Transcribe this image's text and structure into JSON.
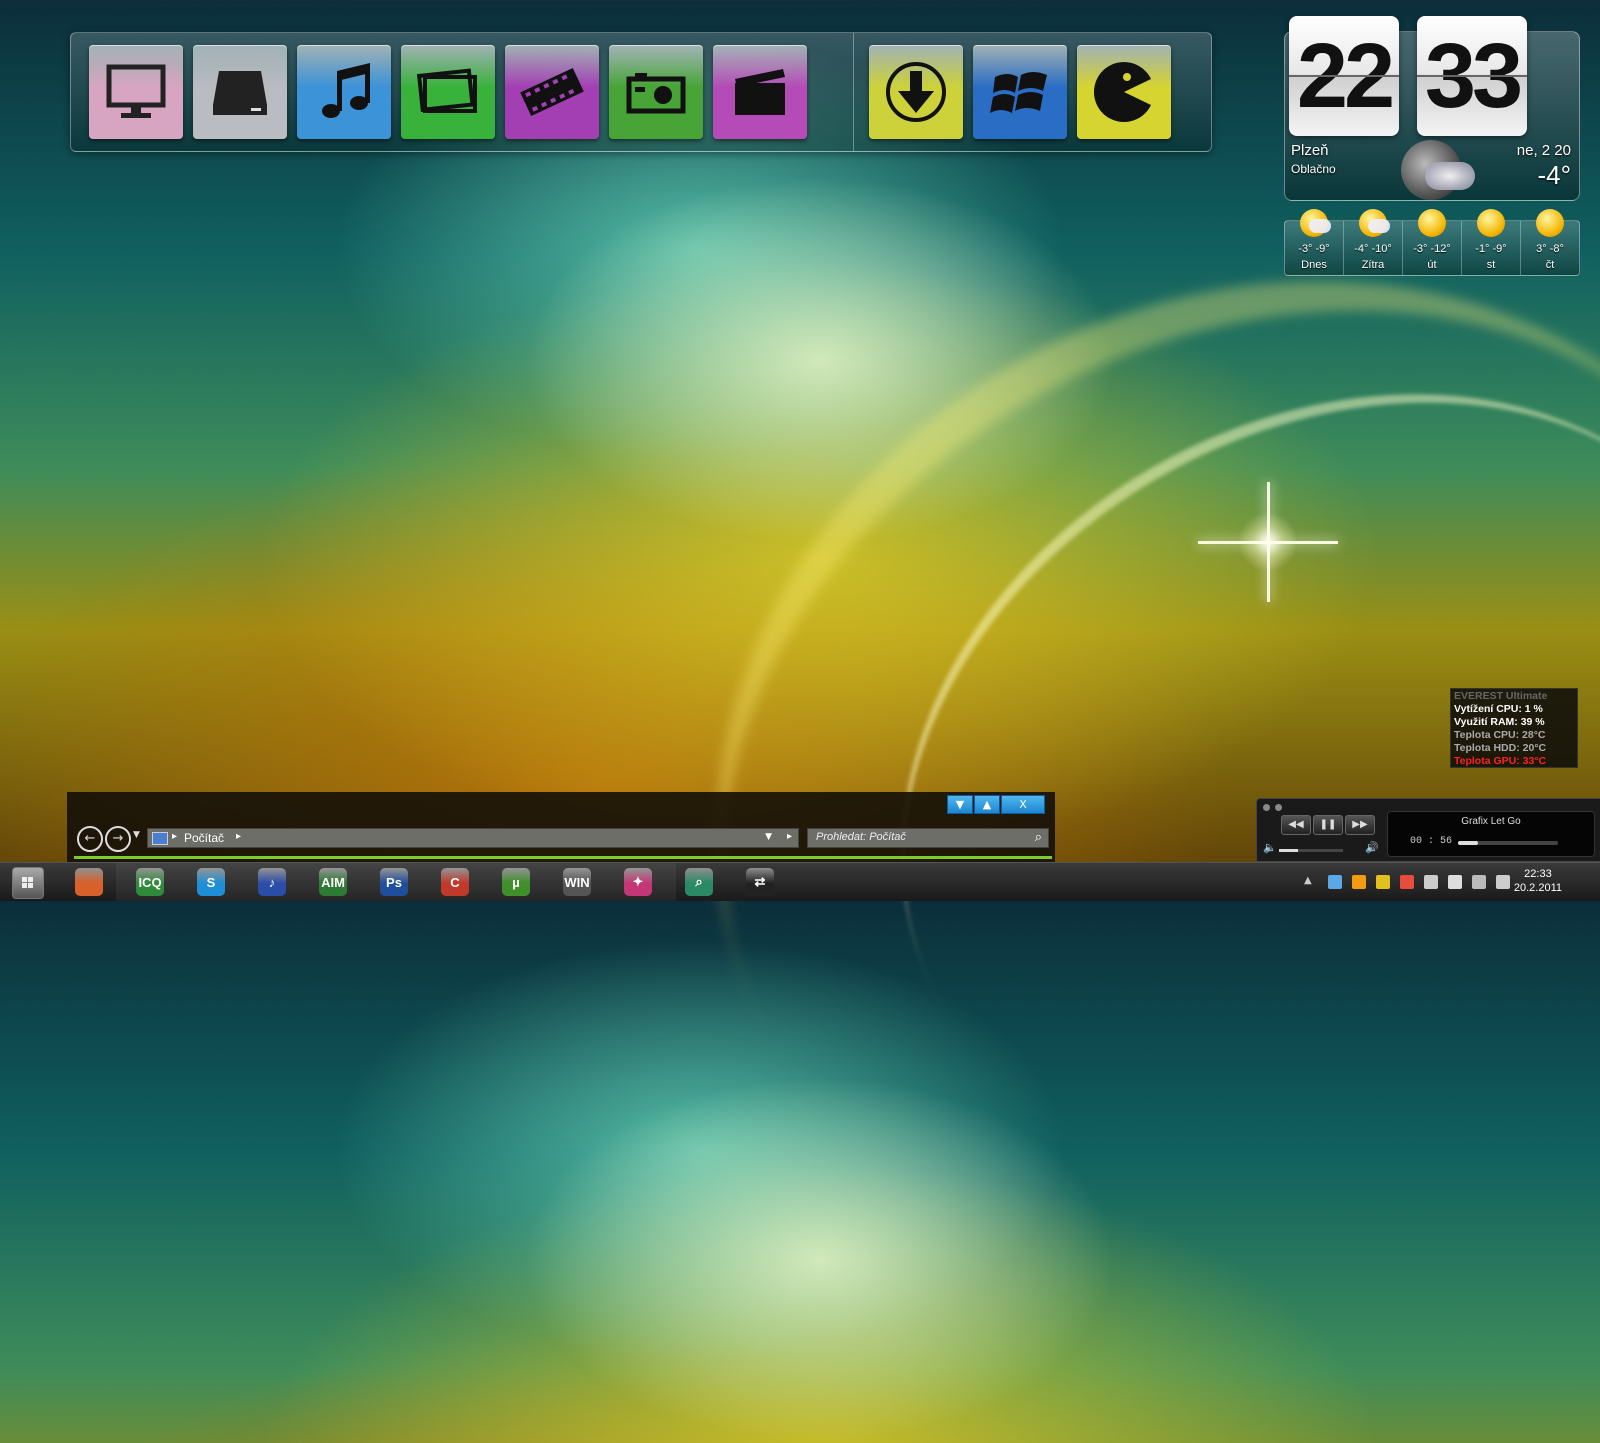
{
  "dock": {
    "tiles": [
      {
        "name": "monitor-icon",
        "color": "#d7a5c1"
      },
      {
        "name": "hard-drive-icon",
        "color": "#b9bcc1"
      },
      {
        "name": "music-note-icon",
        "color": "#3c93d8"
      },
      {
        "name": "pictures-icon",
        "color": "#39b23b"
      },
      {
        "name": "film-strip-icon",
        "color": "#a33fb3"
      },
      {
        "name": "camera-icon",
        "color": "#48a436"
      },
      {
        "name": "clapperboard-icon",
        "color": "#b54bb6"
      },
      {
        "name": "download-icon",
        "color": "#cdd23a"
      },
      {
        "name": "windows-logo-icon",
        "color": "#2a6dc4"
      },
      {
        "name": "pacman-icon",
        "color": "#d6d431"
      }
    ]
  },
  "clock": {
    "hours": "22",
    "minutes": "33"
  },
  "weather": {
    "city": "Plzeň",
    "condition": "Oblačno",
    "date": "ne, 2 20",
    "temp": "-4°",
    "forecast": [
      {
        "temps": "-3° -9°",
        "day": "Dnes",
        "icon": "partly-cloudy-icon"
      },
      {
        "temps": "-4° -10°",
        "day": "Zítra",
        "icon": "partly-cloudy-icon"
      },
      {
        "temps": "-3° -12°",
        "day": "út",
        "icon": "sun-icon"
      },
      {
        "temps": "-1° -9°",
        "day": "st",
        "icon": "sun-icon"
      },
      {
        "temps": "3° -8°",
        "day": "čt",
        "icon": "sun-icon"
      }
    ]
  },
  "everest": {
    "title": "EVEREST Ultimate",
    "cpu_load": "Vytížení CPU: 1 %",
    "ram": "Využití RAM: 39 %",
    "cpu_temp": "Teplota CPU: 28°C",
    "hdd_temp": "Teplota HDD: 20°C",
    "gpu_temp": "Teplota GPU: 33°C",
    "alert_color": "#ff2222"
  },
  "player": {
    "track": "Grafix    Let Go",
    "time": "00 : 56",
    "rewind": "◀◀",
    "pause": "❚❚",
    "forward": "▶▶",
    "progress": 0.2,
    "volume": 0.3
  },
  "explorer": {
    "address": "Počítač",
    "search_placeholder": "Prohledat: Počítač",
    "btn_min": "▼",
    "btn_max": "▲",
    "btn_close": "X",
    "back": "←",
    "forward": "→"
  },
  "taskbar": {
    "apps": [
      {
        "name": "firefox-icon",
        "label": "",
        "color": "#d9602a"
      },
      {
        "name": "icq-icon",
        "label": "ICQ",
        "color": "#2f8a3a"
      },
      {
        "name": "skype-icon",
        "label": "S",
        "color": "#1e8fd6"
      },
      {
        "name": "itunes-icon",
        "label": "♪",
        "color": "#2a4da8"
      },
      {
        "name": "aim-icon",
        "label": "AIM",
        "color": "#2d7a34"
      },
      {
        "name": "photoshop-icon",
        "label": "Ps",
        "color": "#1f4f9c"
      },
      {
        "name": "ccleaner-icon",
        "label": "C",
        "color": "#c0392b"
      },
      {
        "name": "utorrent-icon",
        "label": "µ",
        "color": "#3f8f2a"
      },
      {
        "name": "winamp-icon",
        "label": "WIN",
        "color": "#555555"
      },
      {
        "name": "app-pink-icon",
        "label": "✦",
        "color": "#c43777"
      },
      {
        "name": "search-app-icon",
        "label": "⌕",
        "color": "#2a8a66"
      },
      {
        "name": "app-white-icon",
        "label": "⇄",
        "color": "#222222"
      }
    ],
    "time": "22:33",
    "date": "20.2.2011",
    "tray_icons": [
      "chevron-up-icon",
      "network-icon",
      "orange-app-icon",
      "battery-icon",
      "red-flag-icon",
      "steam-icon",
      "media-icon",
      "monitor-tray-icon",
      "volume-icon"
    ]
  }
}
